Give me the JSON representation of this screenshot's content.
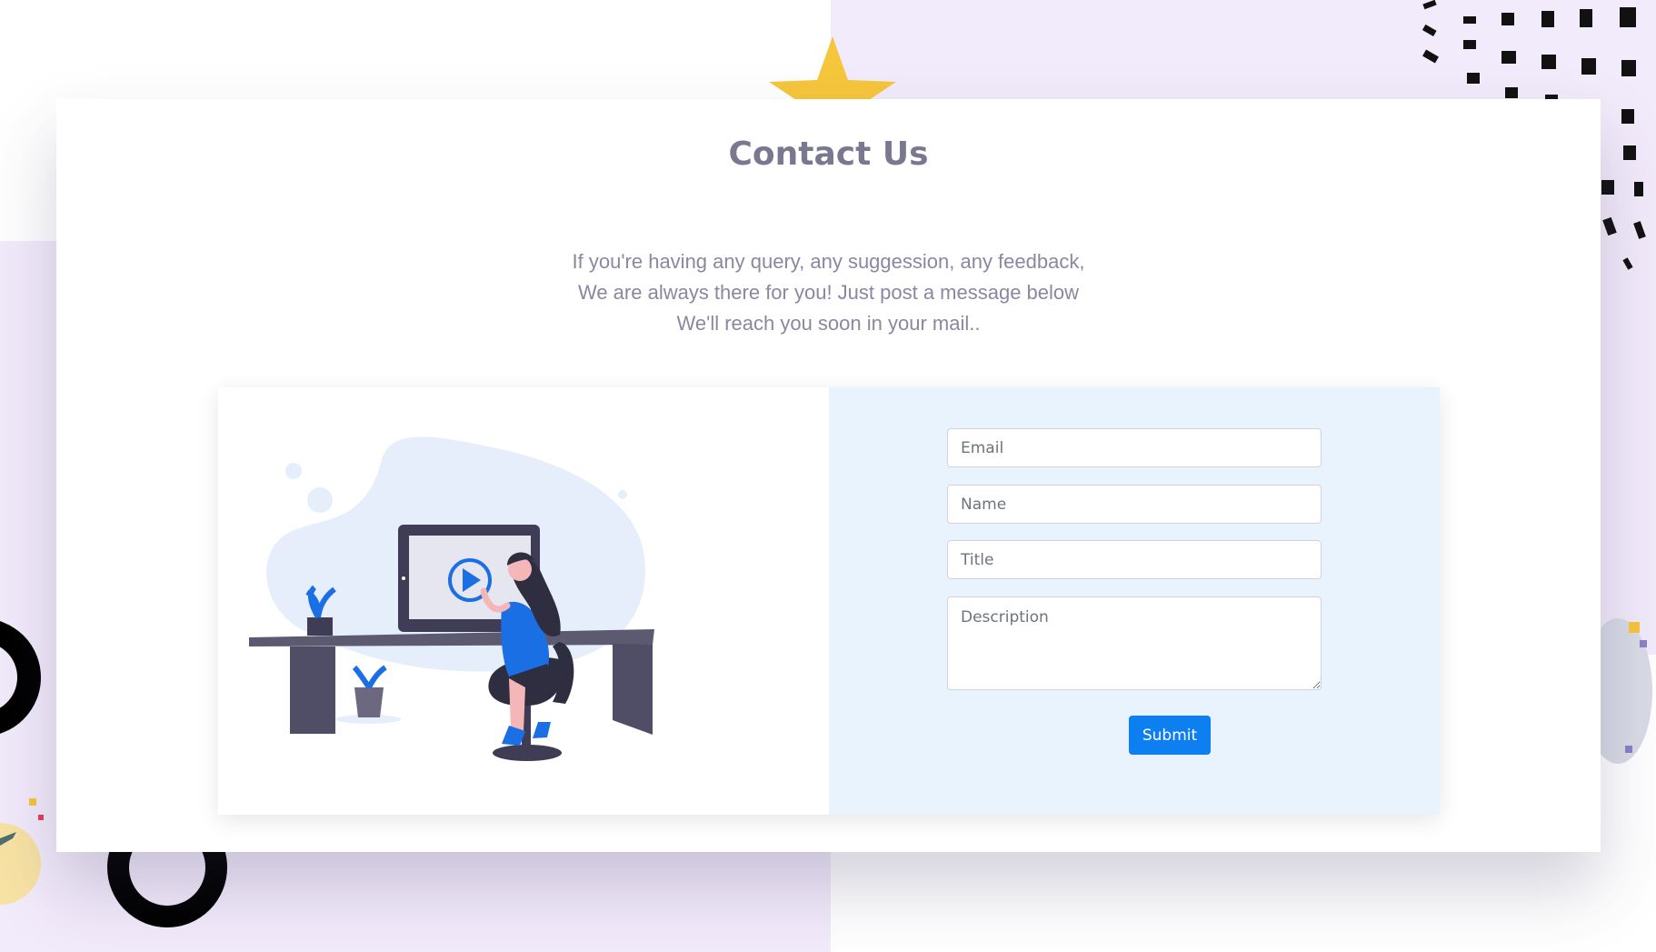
{
  "page": {
    "title": "Contact Us",
    "intro_lines": [
      "If you're having any query, any suggession, any feedback,",
      "We are always there for you! Just post a message below",
      "We'll reach you soon in your mail.."
    ]
  },
  "form": {
    "email_placeholder": "Email",
    "name_placeholder": "Name",
    "title_placeholder": "Title",
    "description_placeholder": "Description",
    "submit_label": "Submit"
  },
  "colors": {
    "accent": "#0d7ff0",
    "form_panel_bg": "#e9f3fe",
    "page_purple": "#f2ebfb",
    "heading": "#7a7891"
  },
  "illustration": {
    "icon": "woman-at-desk-with-video-monitor-illustration"
  }
}
